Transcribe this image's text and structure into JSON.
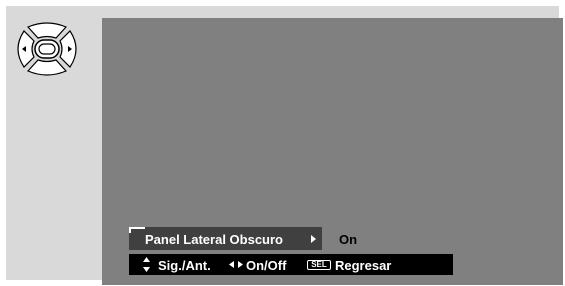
{
  "menu": {
    "item_label": "Panel Lateral Obscuro",
    "item_value": "On"
  },
  "helpbar": {
    "updown_label": "Sig./Ant.",
    "leftright_label": "On/Off",
    "sel_badge": "SEL",
    "select_label": "Regresar"
  },
  "icons": {
    "remote": "remote-dpad-icon",
    "updown": "up-down-arrows-icon",
    "leftright": "left-right-arrows-icon",
    "submenu": "right-triangle-icon"
  },
  "colors": {
    "frame_bg": "#d9d9d9",
    "screen_bg": "#808080",
    "menu_highlight": "#404040",
    "helpbar_bg": "#000000"
  }
}
